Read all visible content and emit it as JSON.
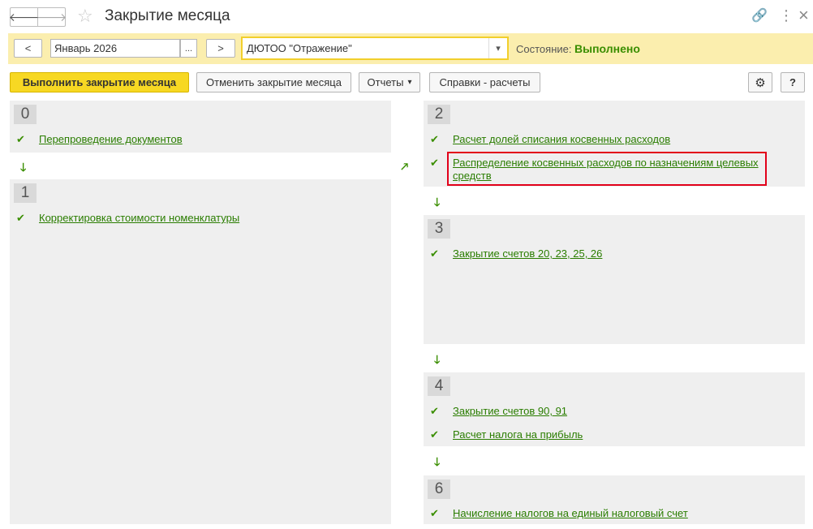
{
  "window": {
    "title": "Закрытие месяца",
    "back_glyph": "🡐",
    "forward_glyph": "🡒",
    "star_glyph": "☆",
    "link_glyph": "🔗",
    "more_glyph": "⋮",
    "close_glyph": "×"
  },
  "period_bar": {
    "prev_label": "<",
    "period_value": "Январь 2026",
    "select_label": "...",
    "next_label": ">",
    "organization_value": "ДЮТОО \"Отражение\"",
    "dropdown_glyph": "▾",
    "state_label": "Состояние:",
    "state_value": "Выполнено",
    "state_color": "#3a8e00",
    "accent_color": "#fbeeae"
  },
  "command_bar": {
    "execute_label": "Выполнить закрытие месяца",
    "cancel_label": "Отменить закрытие месяца",
    "reports_label": "Отчеты",
    "reports_glyph": "▾",
    "help_calc_label": "Справки - расчеты",
    "settings_glyph": "⚙",
    "help_label": "?"
  },
  "steps": {
    "s0": {
      "number": "0",
      "items": [
        "Перепроведение документов"
      ]
    },
    "s1": {
      "number": "1",
      "items": [
        "Корректировка стоимости номенклатуры"
      ]
    },
    "s2": {
      "number": "2",
      "items": [
        "Расчет долей списания косвенных расходов",
        "Распределение косвенных расходов по назначениям целевых средств"
      ]
    },
    "s3": {
      "number": "3",
      "items": [
        "Закрытие счетов 20, 23, 25, 26"
      ]
    },
    "s4": {
      "number": "4",
      "items": [
        "Закрытие счетов 90, 91",
        "Расчет налога на прибыль"
      ]
    },
    "s6": {
      "number": "6",
      "items": [
        "Начисление налогов на единый налоговый счет"
      ]
    }
  },
  "glyphs": {
    "check": "✔",
    "arrow_down": "🡓",
    "arrow_diag": "🡕"
  },
  "highlight_color": "#e2001a"
}
